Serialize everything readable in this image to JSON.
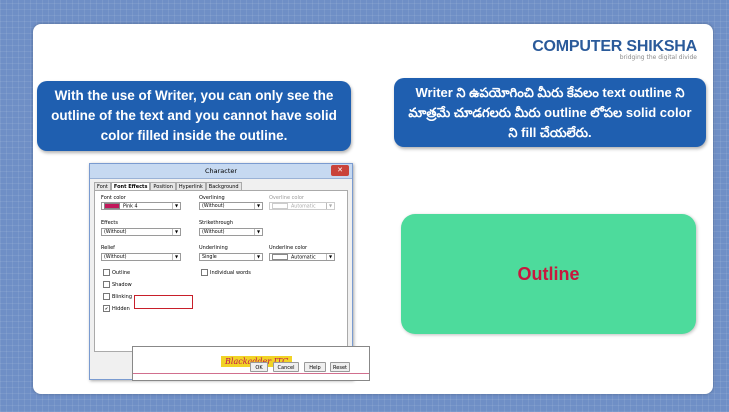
{
  "logo": {
    "main": "COMPUTER SHIKSHA",
    "tagline": "bridging the digital divide"
  },
  "callout_en": "With the use of Writer, you can only see the outline of the text and you cannot have solid color filled inside the outline.",
  "callout_te": "Writer ని ఉపయోగించి మీరు కేవలం text outline ని మాత్రమే చూడగలరు మీరు outline లోపల solid color ని fill చేయలేరు.",
  "answer": "Outline",
  "dialog": {
    "title": "Character",
    "close": "✕",
    "tabs": [
      "Font",
      "Font Effects",
      "Position",
      "Hyperlink",
      "Background"
    ],
    "font_color_label": "Font color",
    "font_color_value": "Pink 4",
    "font_color_swatch": "#c2185b",
    "effects_label": "Effects",
    "effects_value": "(Without)",
    "relief_label": "Relief",
    "relief_value": "(Without)",
    "overlining_label": "Overlining",
    "overlining_value": "(Without)",
    "overline_color_label": "Overline color",
    "overline_color_value": "Automatic",
    "strikethrough_label": "Strikethrough",
    "strikethrough_value": "(Without)",
    "underlining_label": "Underlining",
    "underlining_value": "Single",
    "underline_color_label": "Underline color",
    "underline_color_value": "Automatic",
    "individual_words": "Individual words",
    "outline": "Outline",
    "shadow": "Shadow",
    "blinking": "Blinking",
    "hidden": "Hidden",
    "preview_text": "Blackadder ITC",
    "ok": "OK",
    "cancel": "Cancel",
    "help": "Help",
    "reset": "Reset"
  },
  "colors": {
    "accent": "#1f5fb0",
    "answer_bg": "#4ddb9c",
    "answer_text": "#c8173e",
    "highlight": "#c81f2a"
  }
}
